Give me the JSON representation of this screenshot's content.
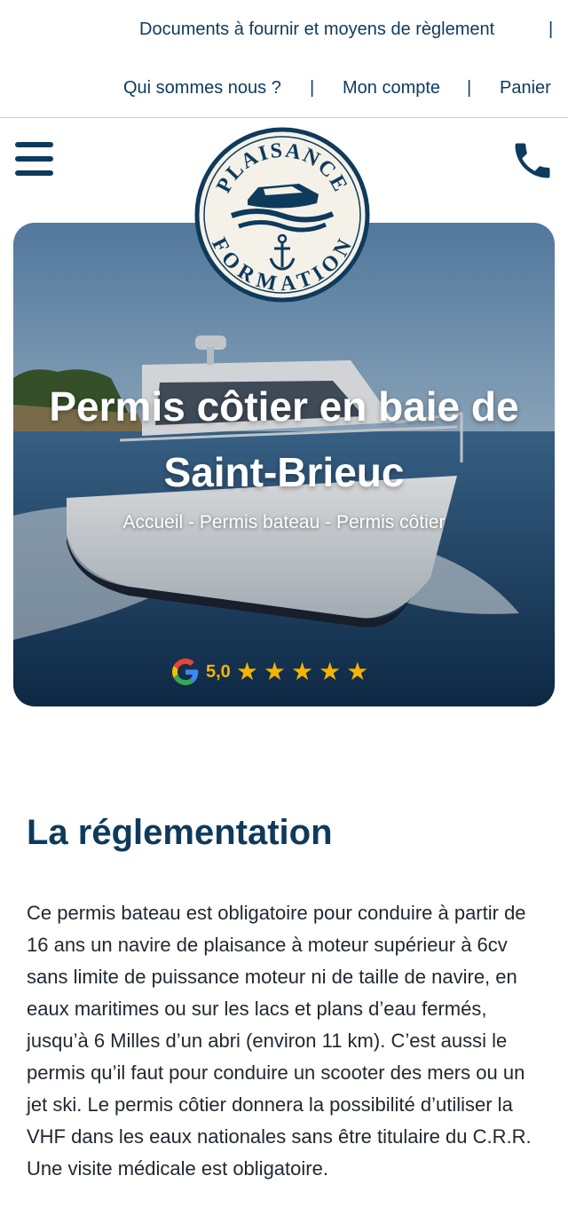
{
  "top_nav": {
    "documents_link": "Documents à fournir et moyens de règlement",
    "separator": "|",
    "about_link": "Qui sommes nous ?",
    "account_link": "Mon compte",
    "cart_link": "Panier"
  },
  "header": {
    "menu_icon": "hamburger-menu-icon",
    "phone_icon": "phone-icon",
    "logo": {
      "top_text": "PLAISANCE",
      "bottom_text": "FORMATION",
      "symbols": [
        "boat",
        "waves",
        "anchor"
      ]
    }
  },
  "hero": {
    "title_line1": "Permis côtier en baie de",
    "title_line2": "Saint-Brieuc",
    "breadcrumb": [
      "Accueil",
      "Permis bateau",
      "Permis côtier"
    ],
    "breadcrumb_separator": " - ",
    "rating": {
      "provider_icon": "google-icon",
      "value": "5,0",
      "stars": 5,
      "max_stars": 5
    }
  },
  "content": {
    "title": "La réglementation",
    "paragraph": "Ce permis bateau est obligatoire pour conduire à partir de 16 ans un navire de plaisance à moteur supérieur à 6cv sans limite de puissance moteur ni de taille de navire, en eaux maritimes ou sur les lacs et plans d’eau fermés, jusqu’à 6 Milles d’un abri (environ 11 km). C’est aussi le permis qu’il faut pour conduire un scooter des mers ou un jet ski. Le permis côtier donnera la possibilité d’utiliser la VHF dans les eaux nationales sans être titulaire du C.R.R. Une visite médicale est obligatoire."
  },
  "colors": {
    "brand_navy": "#0e3a5c",
    "star_gold": "#f4b400",
    "logo_background": "#f4f1e8"
  }
}
